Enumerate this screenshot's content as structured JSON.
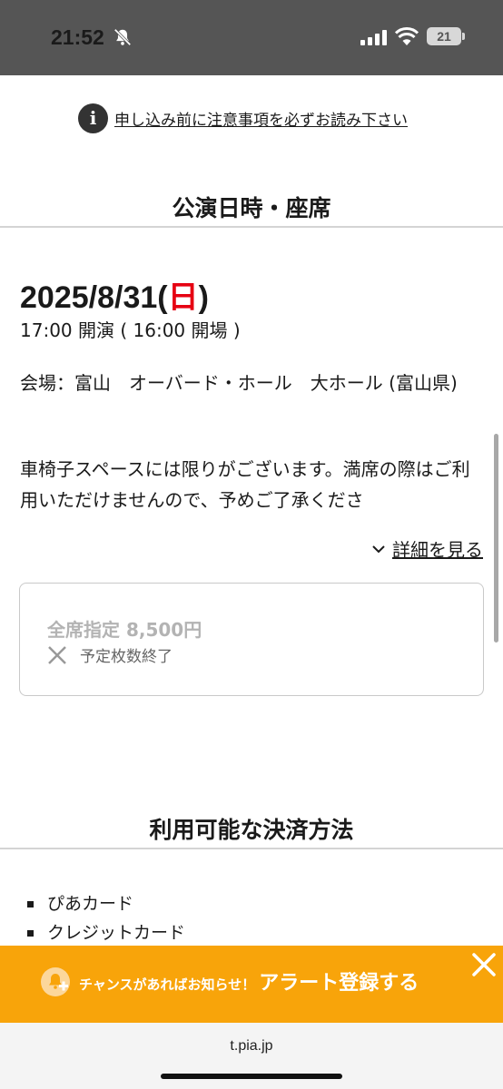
{
  "status_bar": {
    "time": "21:52",
    "battery": "21"
  },
  "notice": {
    "link_text": "申し込み前に注意事項を必ずお読み下さい"
  },
  "performance": {
    "section_title": "公演日時・座席",
    "date": "2025/8/31(",
    "weekday": "日",
    "date_close": ")",
    "time_line": "17:00 開演 ( 16:00 開場 )",
    "venue": "会場：富山　オーバード・ホール　大ホール (富山県)",
    "note": "車椅子スペースには限りがございます。満席の際はご利用いただけませんので、予めご了承くださ",
    "details_label": "詳細を見る",
    "ticket": {
      "name": "全席指定 8,500円",
      "status": "予定枚数終了"
    }
  },
  "payment": {
    "section_title": "利用可能な決済方法",
    "methods": [
      "ぴあカード",
      "クレジットカード"
    ]
  },
  "alert": {
    "small_text": "チャンスがあればお知らせ！",
    "big_text": "アラート登録する"
  },
  "browser": {
    "url": "t.pia.jp"
  },
  "colors": {
    "accent_orange": "#f8a40a",
    "sunday_red": "#e60012"
  }
}
